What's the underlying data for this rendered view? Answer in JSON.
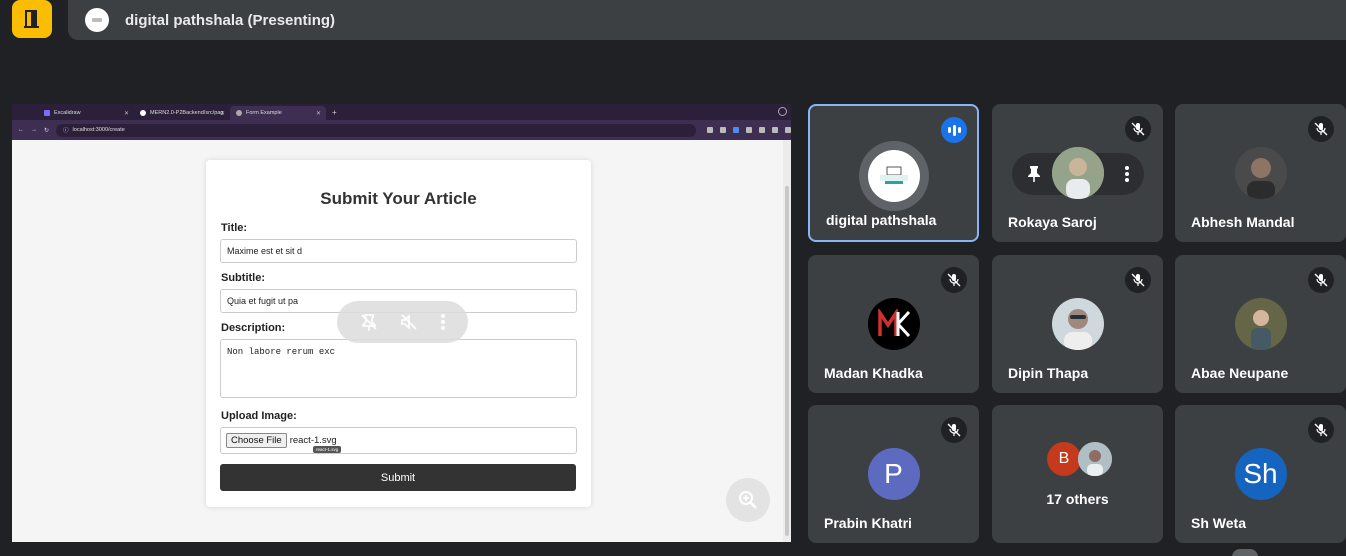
{
  "meeting": {
    "presenter_title": "digital pathshala (Presenting)"
  },
  "browser": {
    "tabs": [
      {
        "label": "Excalidraw",
        "active": false
      },
      {
        "label": "MERN2.0-P2Backend/src/pag",
        "active": false
      },
      {
        "label": "Form Example",
        "active": true
      }
    ],
    "url": "localhost:3000/create"
  },
  "form": {
    "heading": "Submit Your Article",
    "title_label": "Title:",
    "title_value": "Maxime est et sit d",
    "subtitle_label": "Subtitle:",
    "subtitle_value": "Quia et fugit ut pa",
    "description_label": "Description:",
    "description_value": "Non labore rerum exc",
    "upload_label": "Upload Image:",
    "choose_file_label": "Choose File",
    "file_name": "react-1.svg",
    "file_tooltip": "react-1.svg",
    "submit_label": "Submit"
  },
  "participants": [
    {
      "name": "digital pathshala",
      "speaking": true,
      "avatar": "logo"
    },
    {
      "name": "Rokaya Saroj",
      "muted": true,
      "avatar": "photo"
    },
    {
      "name": "Abhesh Mandal",
      "muted": true,
      "avatar": "photo"
    },
    {
      "name": "Madan Khadka",
      "muted": true,
      "avatar": "logo-mk"
    },
    {
      "name": "Dipin Thapa",
      "muted": true,
      "avatar": "photo"
    },
    {
      "name": "Abae Neupane",
      "muted": true,
      "avatar": "photo"
    },
    {
      "name": "Prabin Khatri",
      "muted": true,
      "avatar_letter": "P",
      "avatar_color": "#5c6bc0"
    },
    {
      "name": "17 others",
      "group": true,
      "avatar_letter": "B",
      "avatar_color": "#c5391c"
    },
    {
      "name": "Sh Weta",
      "muted": true,
      "avatar_letter": "Sh",
      "avatar_color": "#1565c0"
    }
  ],
  "colors": {
    "background": "#202124",
    "tile": "#3c4043",
    "accent_yellow": "#fbbc04",
    "speaking_blue": "#1a73e8"
  }
}
